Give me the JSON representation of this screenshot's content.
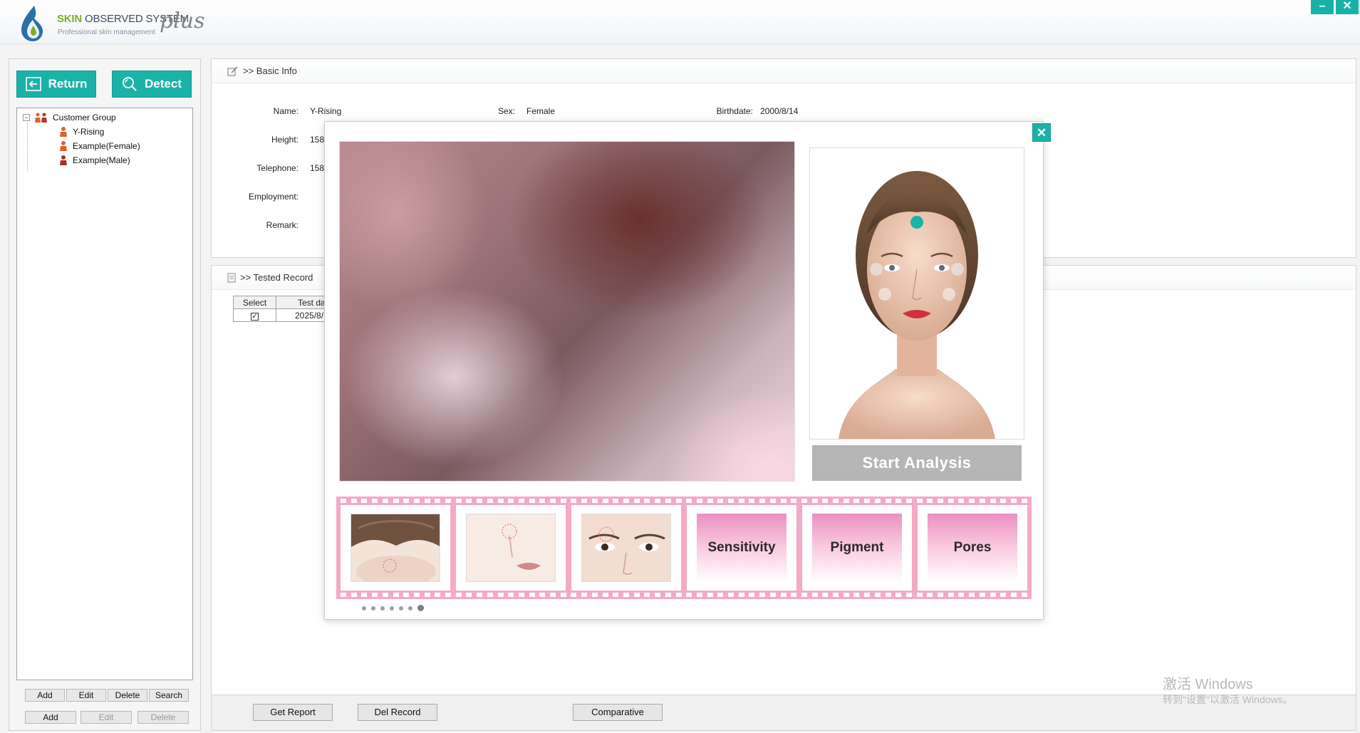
{
  "app": {
    "brand_skin": "SKIN",
    "brand_rest": "OBSERVED SYSTEM",
    "brand_sub": "Professional skin management",
    "brand_plus": "plus",
    "minimize": "–",
    "close": "✕"
  },
  "toolbar": {
    "return_label": "Return",
    "detect_label": "Detect"
  },
  "tree": {
    "root": "Customer Group",
    "toggle": "−",
    "items": [
      "Y-Rising",
      "Example(Female)",
      "Example(Male)"
    ]
  },
  "left_buttons": {
    "row1": [
      "Add",
      "Edit",
      "Delete",
      "Search"
    ],
    "row2": [
      "Add",
      "Edit",
      "Delete"
    ]
  },
  "basic_info": {
    "title": ">> Basic Info",
    "name_label": "Name:",
    "name_value": "Y-Rising",
    "sex_label": "Sex:",
    "sex_value": "Female",
    "birthdate_label": "Birthdate:",
    "birthdate_value": "2000/8/14",
    "height_label": "Height:",
    "height_value": "158",
    "telephone_label": "Telephone:",
    "telephone_value": "158",
    "employment_label": "Employment:",
    "remark_label": "Remark:"
  },
  "tested_record": {
    "title": ">> Tested Record",
    "columns": [
      "Select",
      "Test da"
    ],
    "rows": [
      {
        "checked": "✓",
        "date": "2025/8/"
      }
    ]
  },
  "bottom_bar": {
    "get_report": "Get Report",
    "del_record": "Del Record",
    "comparative": "Comparative"
  },
  "watermark": {
    "line1": "激活 Windows",
    "line2": "转到\"设置\"以激活 Windows。"
  },
  "modal": {
    "close": "✕",
    "start_analysis": "Start Analysis",
    "cards": [
      "Sensitivity",
      "Pigment",
      "Pores"
    ],
    "page_dots": 7,
    "active_dot": 7
  },
  "colors": {
    "accent": "#1bb3a8",
    "film": "#f4a9c7",
    "start_disabled": "#b5b5b5"
  }
}
